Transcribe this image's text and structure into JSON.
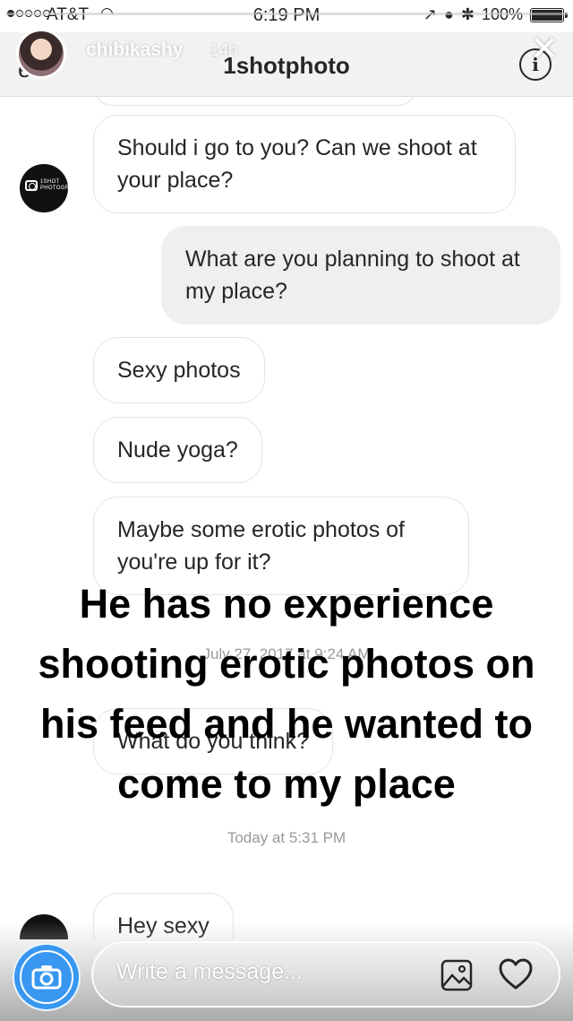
{
  "status_bar": {
    "carrier": "AT&T",
    "time": "6:19 PM",
    "battery": "100%"
  },
  "story": {
    "username": "chibikashy",
    "time_ago": "14h",
    "progress": 0.0,
    "overlay_text": "He has no experience shooting erotic photos on his feed and he wanted to come to my place"
  },
  "header": {
    "back_label": "e",
    "title": "1shotphoto",
    "info_label": "i"
  },
  "messages": [
    {
      "side": "received",
      "text": "Should i go to you? Can we shoot at your place?"
    },
    {
      "side": "sent",
      "text": "What are you planning to shoot at my place?"
    },
    {
      "side": "received",
      "text": "Sexy photos"
    },
    {
      "side": "received",
      "text": "Nude yoga?"
    },
    {
      "side": "received",
      "text": "Maybe some erotic photos of you're up for it?"
    },
    {
      "side": "timestamp",
      "text": "July 27, 2017 at 9:24 AM"
    },
    {
      "side": "received",
      "text": "What do you think?"
    },
    {
      "side": "timestamp",
      "text": "Today at 5:31 PM"
    },
    {
      "side": "received",
      "text": "Hey sexy"
    }
  ],
  "sender": {
    "avatar_brand": "1SHOT PHOTOGRAPHY"
  },
  "composer": {
    "placeholder": "Write a message..."
  },
  "colors": {
    "accent_blue": "#3897f0",
    "header_bg": "#f2f2f2",
    "sent_bubble": "#efefef"
  },
  "icons": {
    "camera": "camera-icon",
    "gallery": "gallery-icon",
    "heart": "heart-icon",
    "info": "info-icon",
    "close": "close-icon"
  }
}
